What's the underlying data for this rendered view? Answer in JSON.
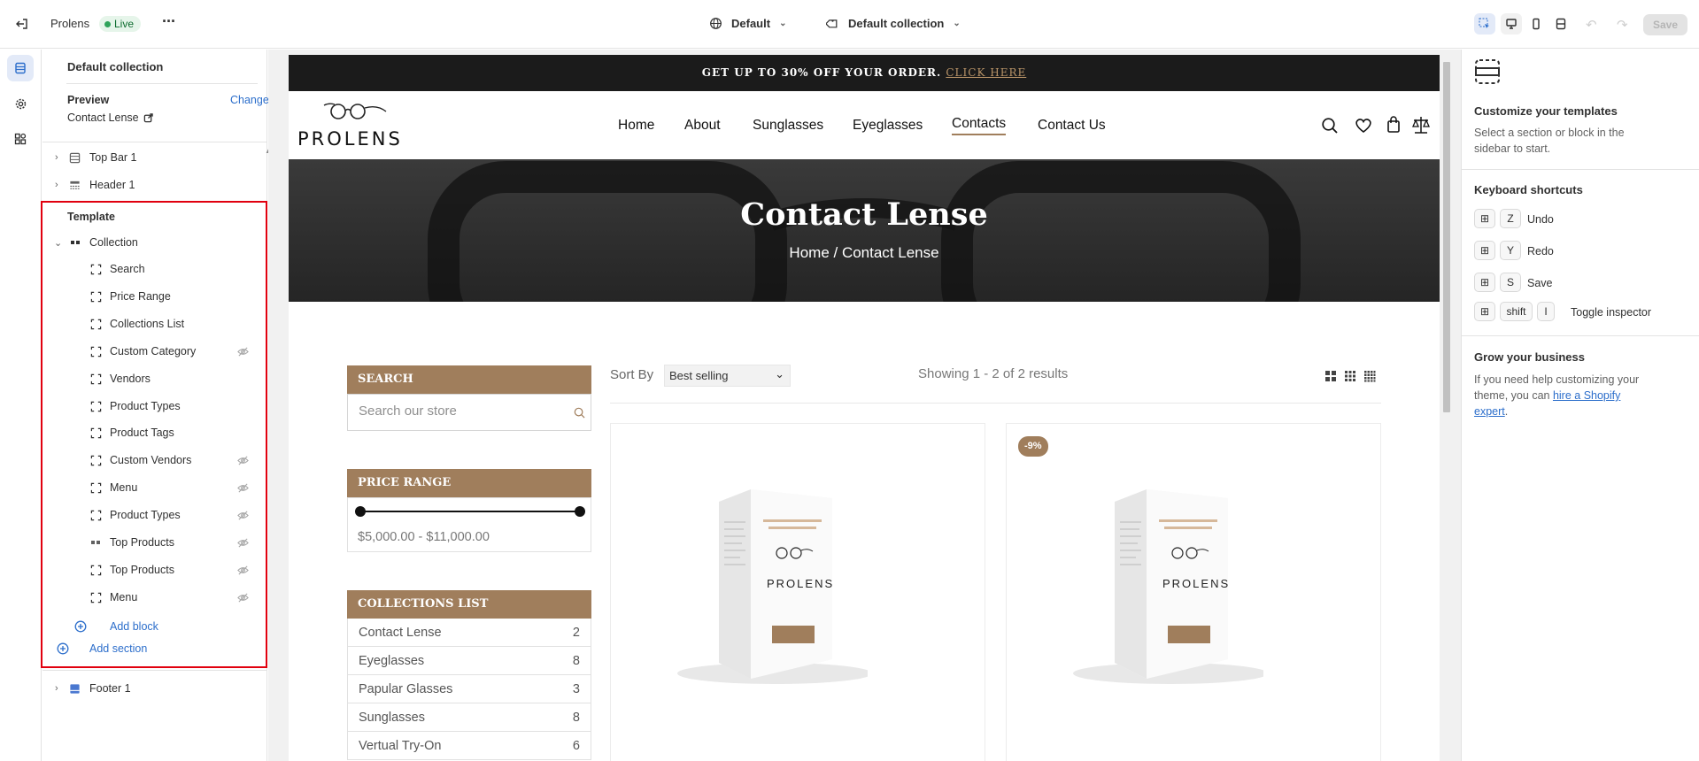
{
  "topbar": {
    "store_name": "Prolens",
    "status": "Live",
    "more": "···",
    "locale": "Default",
    "template": "Default collection",
    "save_label": "Save"
  },
  "sidebar": {
    "title": "Default collection",
    "preview_label": "Preview",
    "change_label": "Change",
    "preview_value": "Contact Lense",
    "sections": [
      {
        "label": "Top Bar 1"
      },
      {
        "label": "Header 1"
      }
    ],
    "template_label": "Template",
    "collection_label": "Collection",
    "blocks": [
      {
        "label": "Search",
        "hidden": false
      },
      {
        "label": "Price Range",
        "hidden": false
      },
      {
        "label": "Collections List",
        "hidden": false
      },
      {
        "label": "Custom Category",
        "hidden": true
      },
      {
        "label": "Vendors",
        "hidden": false
      },
      {
        "label": "Product Types",
        "hidden": false
      },
      {
        "label": "Product Tags",
        "hidden": false
      },
      {
        "label": "Custom Vendors",
        "hidden": true
      },
      {
        "label": "Menu",
        "hidden": true
      },
      {
        "label": "Product Types",
        "hidden": true
      },
      {
        "label": "Top Products",
        "hidden": true
      },
      {
        "label": "Top Products",
        "hidden": true
      },
      {
        "label": "Menu",
        "hidden": true
      }
    ],
    "add_block": "Add block",
    "add_section": "Add section",
    "footer": "Footer 1"
  },
  "store": {
    "promo_text": "GET UP TO 30% OFF YOUR ORDER.",
    "promo_link": "CLICK HERE",
    "logo": "PROLENS",
    "nav": [
      "Home",
      "About",
      "Sunglasses",
      "Eyeglasses",
      "Contacts",
      "Contact Us"
    ],
    "active_nav": "Contacts",
    "hero_title": "Contact Lense",
    "breadcrumb": "Home / Contact Lense",
    "search_heading": "SEARCH",
    "search_placeholder": "Search our store",
    "price_heading": "PRICE RANGE",
    "price_range": "$5,000.00 - $11,000.00",
    "collections_heading": "COLLECTIONS LIST",
    "collections": [
      {
        "name": "Contact Lense",
        "count": "2"
      },
      {
        "name": "Eyeglasses",
        "count": "8"
      },
      {
        "name": "Papular Glasses",
        "count": "3"
      },
      {
        "name": "Sunglasses",
        "count": "8"
      },
      {
        "name": "Vertual Try-On",
        "count": "6"
      }
    ],
    "sort_label": "Sort By",
    "sort_value": "Best selling",
    "results_text": "Showing 1 - 2 of 2 results",
    "product_badge": "-9%",
    "box_logo": "PROLENS",
    "accent": "#a07e5c"
  },
  "right_panel": {
    "customize_title": "Customize your templates",
    "customize_text": "Select a section or block in the sidebar to start.",
    "shortcuts_title": "Keyboard shortcuts",
    "shortcuts": [
      {
        "key": "Z",
        "label": "Undo"
      },
      {
        "key": "Y",
        "label": "Redo"
      },
      {
        "key": "S",
        "label": "Save"
      }
    ],
    "inspector_shift": "shift",
    "inspector_key": "I",
    "inspector_label": "Toggle inspector",
    "grow_title": "Grow your business",
    "grow_text": "If you need help customizing your theme, you can",
    "grow_link": "hire a Shopify expert",
    "grow_end": "."
  }
}
